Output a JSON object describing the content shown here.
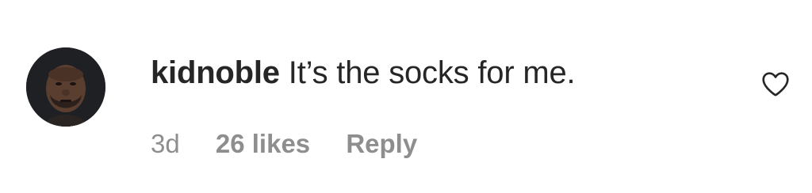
{
  "comment": {
    "username": "kidnoble",
    "text": "It’s the socks for me.",
    "time": "3d",
    "likes": "26 likes",
    "reply_label": "Reply",
    "avatar_icon": "user-avatar-icon",
    "like_icon": "heart-outline-icon"
  },
  "colors": {
    "primary_text": "#262626",
    "secondary_text": "#8e8e8e",
    "background": "#ffffff"
  }
}
